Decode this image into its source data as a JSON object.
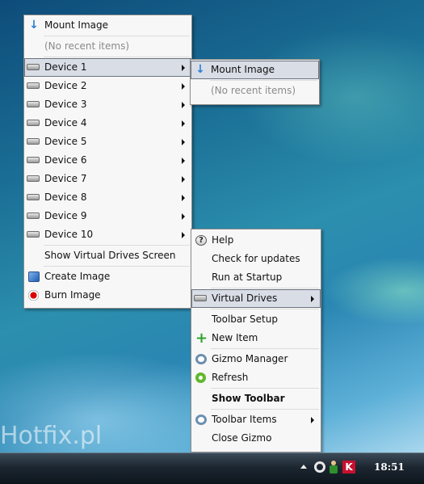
{
  "watermark": "Hotfix.pl",
  "main_menu": {
    "mount_image": "Mount Image",
    "no_recent": "(No recent items)",
    "devices": [
      "Device 1",
      "Device 2",
      "Device 3",
      "Device 4",
      "Device 5",
      "Device 6",
      "Device 7",
      "Device 8",
      "Device 9",
      "Device 10"
    ],
    "show_screen": "Show Virtual Drives Screen",
    "create_image": "Create Image",
    "burn_image": "Burn Image"
  },
  "device_submenu": {
    "mount_image": "Mount Image",
    "no_recent": "(No recent items)"
  },
  "gizmo_menu": {
    "help": "Help",
    "check_updates": "Check for updates",
    "run_startup": "Run at Startup",
    "virtual_drives": "Virtual Drives",
    "toolbar_setup": "Toolbar Setup",
    "new_item": "New Item",
    "gizmo_manager": "Gizmo Manager",
    "refresh": "Refresh",
    "show_toolbar": "Show Toolbar",
    "toolbar_items": "Toolbar Items",
    "close_gizmo": "Close Gizmo"
  },
  "taskbar": {
    "clock": "18:51"
  },
  "colors": {
    "highlight": "#d8dde6",
    "menu_bg": "#f7f7f7",
    "kaspersky": "#c8102e"
  },
  "icons": [
    "mount-icon",
    "drive-icon",
    "create-image-icon",
    "burn-icon",
    "help-icon",
    "plus-icon",
    "gizmo-icon",
    "refresh-icon",
    "show-hidden-icons-icon",
    "network-icon",
    "kaspersky-icon"
  ]
}
